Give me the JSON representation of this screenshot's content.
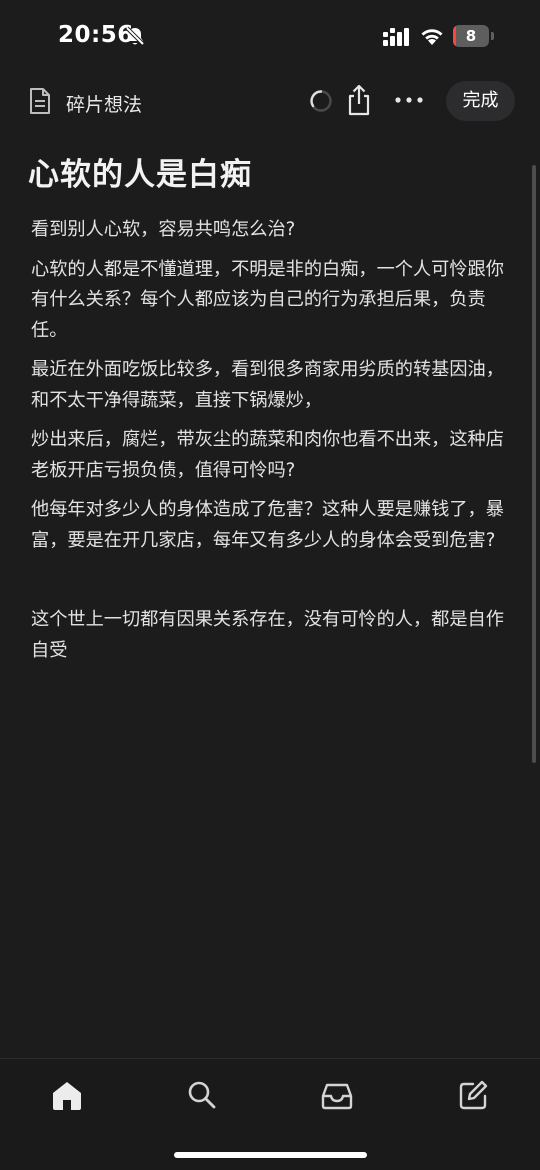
{
  "status_bar": {
    "time": "20:56",
    "battery_level": "8",
    "battery_fraction": 0.08,
    "icons": [
      "bell-slash-icon",
      "signal-icon",
      "wifi-icon",
      "battery-icon"
    ]
  },
  "toolbar": {
    "folder_name": "碎片想法",
    "done_label": "完成",
    "icons": [
      "document-icon",
      "loading-spinner-icon",
      "share-icon",
      "more-icon"
    ]
  },
  "note": {
    "title": "心软的人是白痴",
    "paragraphs": [
      "看到别人心软，容易共鸣怎么治?",
      "心软的人都是不懂道理，不明是非的白痴，一个人可怜跟你有什么关系？每个人都应该为自己的行为承担后果，负责任。",
      "最近在外面吃饭比较多，看到很多商家用劣质的转基因油，和不太干净得蔬菜，直接下锅爆炒，",
      "炒出来后，腐烂，带灰尘的蔬菜和肉你也看不出来，这种店老板开店亏损负债，值得可怜吗?",
      "他每年对多少人的身体造成了危害？这种人要是赚钱了，暴富，要是在开几家店，每年又有多少人的身体会受到危害?",
      "这个世上一切都有因果关系存在，没有可怜的人，都是自作自受"
    ]
  },
  "tab_bar": {
    "items": [
      "home-icon",
      "search-icon",
      "inbox-icon",
      "compose-icon"
    ],
    "active": "home-icon"
  },
  "colors": {
    "background": "#1c1c1c",
    "text": "#e2e2e2",
    "battery_low": "#ff453a",
    "button_bg": "#2c2c2e"
  }
}
